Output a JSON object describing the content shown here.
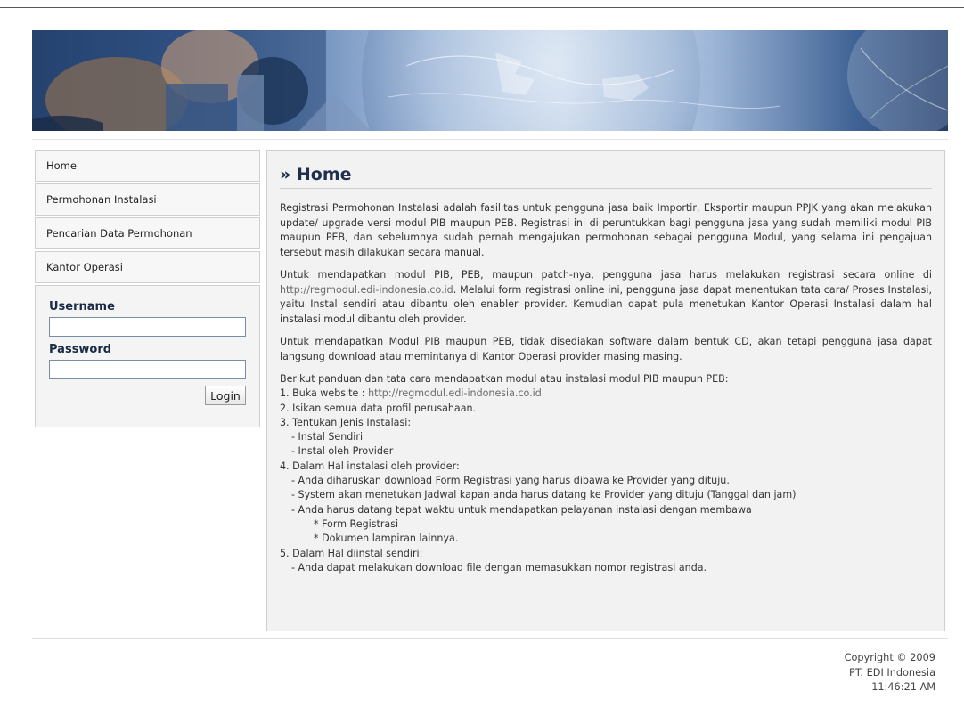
{
  "nav": {
    "items": [
      {
        "label": "Home"
      },
      {
        "label": "Permohonan Instalasi"
      },
      {
        "label": "Pencarian Data Permohonan"
      },
      {
        "label": "Kantor Operasi"
      }
    ]
  },
  "login": {
    "username_label": "Username",
    "username_value": "",
    "password_label": "Password",
    "password_value": "",
    "button_label": "Login"
  },
  "main": {
    "title": "» Home",
    "para1": "Registrasi Permohonan Instalasi adalah fasilitas untuk pengguna jasa baik Importir, Eksportir maupun PPJK yang akan melakukan update/ upgrade versi modul PIB maupun PEB. Registrasi ini di peruntukkan bagi pengguna jasa yang sudah memiliki modul PIB maupun PEB, dan sebelumnya sudah pernah mengajukan permohonan sebagai pengguna Modul, yang selama ini pengajuan tersebut masih dilakukan secara manual.",
    "para2_before": "Untuk mendapatkan modul PIB, PEB, maupun patch-nya, pengguna jasa harus melakukan registrasi secara online di ",
    "para2_link": "http://regmodul.edi-indonesia.co.id",
    "para2_after": ". Melalui form registrasi online ini, pengguna jasa dapat menentukan tata cara/ Proses Instalasi, yaitu Instal sendiri atau dibantu oleh enabler provider. Kemudian dapat pula menetukan Kantor Operasi Instalasi dalam hal instalasi modul dibantu oleh provider.",
    "para3": "Untuk mendapatkan Modul PIB maupun PEB, tidak disediakan software dalam bentuk CD, akan tetapi pengguna jasa dapat langsung download atau memintanya di Kantor Operasi provider masing masing.",
    "guide_intro": "Berikut panduan dan tata cara mendapatkan modul atau instalasi modul PIB maupun PEB:",
    "step1_prefix": "1. Buka website : ",
    "step1_link": "http://regmodul.edi-indonesia.co.id",
    "step2": "2. Isikan semua data profil perusahaan.",
    "step3": "3. Tentukan Jenis Instalasi:",
    "step3a": "- Instal Sendiri",
    "step3b": "- Instal oleh Provider",
    "step4": "4. Dalam Hal instalasi oleh provider:",
    "step4a": "- Anda diharuskan download Form Registrasi yang harus dibawa ke Provider yang dituju.",
    "step4b": "- System akan menetukan Jadwal kapan anda harus datang ke Provider yang dituju (Tanggal dan jam)",
    "step4c": "- Anda harus datang tepat waktu untuk mendapatkan pelayanan instalasi dengan membawa",
    "step4c1": "* Form Registrasi",
    "step4c2": "* Dokumen lampiran lainnya.",
    "step5": "5. Dalam Hal diinstal sendiri:",
    "step5a": "- Anda dapat melakukan download file dengan memasukkan nomor registrasi anda."
  },
  "footer": {
    "copyright": "Copyright © 2009",
    "company": "PT. EDI Indonesia",
    "time": "11:46:21 AM"
  },
  "colors": {
    "title": "#1f2f4d",
    "link": "#6a6a6a",
    "content_bg": "#f2f2f2"
  }
}
